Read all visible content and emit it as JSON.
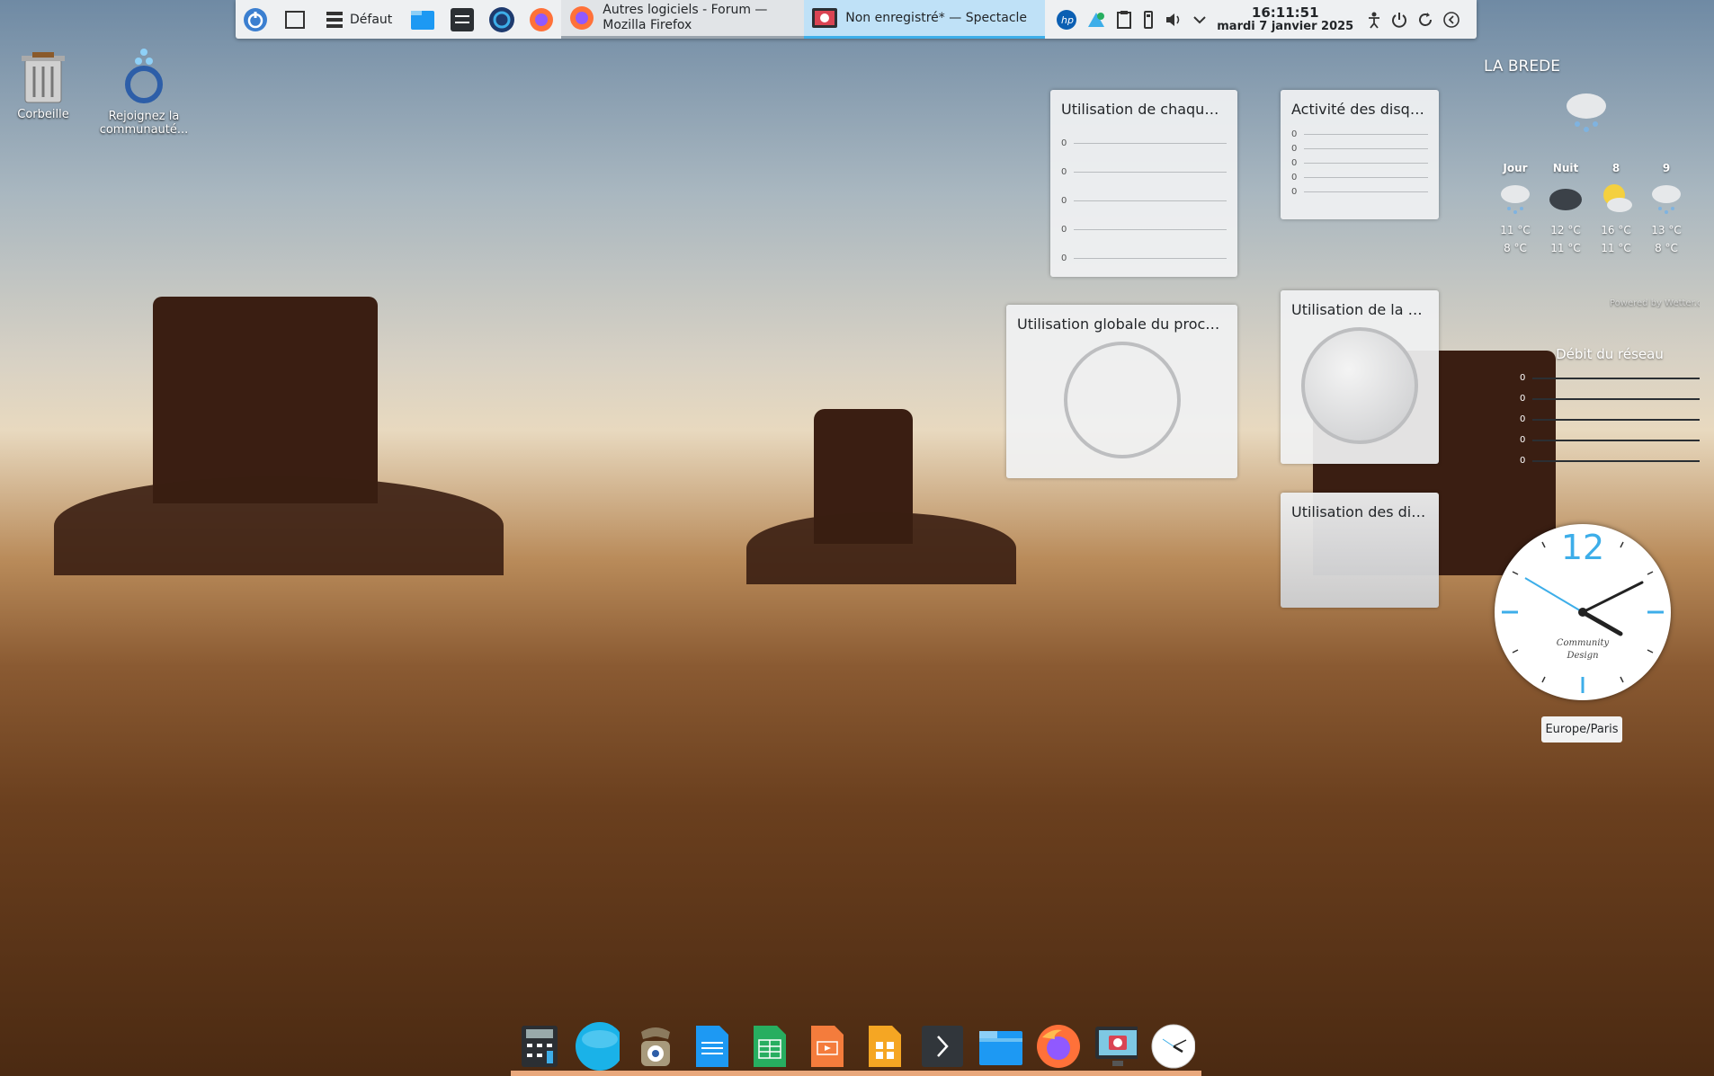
{
  "panel": {
    "launcher_icon": "kde-launcher-icon",
    "desktop_label": "Défaut",
    "tasks": [
      {
        "title": "Autres logiciels - Forum — Mozilla Firefox",
        "icon": "firefox-icon"
      },
      {
        "title": "Non enregistré* — Spectacle",
        "icon": "spectacle-icon"
      }
    ],
    "clock": {
      "time": "16:11:51",
      "date": "mardi 7 janvier 2025"
    }
  },
  "desktop_icons": [
    {
      "label": "Corbeille",
      "icon": "trash-icon"
    },
    {
      "label": "Rejoignez la communauté...",
      "icon": "community-icon"
    }
  ],
  "widgets": {
    "cpu_each": {
      "title": "Utilisation de chaque c...",
      "values": [
        "0",
        "0",
        "0",
        "0",
        "0"
      ]
    },
    "disk_activity": {
      "title": "Activité des disqu...",
      "values": [
        "0",
        "0",
        "0",
        "0",
        "0"
      ]
    },
    "cpu_global": {
      "title": "Utilisation globale du proces..."
    },
    "memory": {
      "title": "Utilisation de la m..."
    },
    "disks": {
      "title": "Utilisation des dis..."
    }
  },
  "weather": {
    "location": "LA BREDE",
    "powered_by": "Powered by Wetter.com",
    "forecast": [
      {
        "label": "Jour",
        "high": "11 °C",
        "low": "8 °C",
        "icon": "snow-rain-icon"
      },
      {
        "label": "Nuit",
        "high": "12 °C",
        "low": "11 °C",
        "icon": "dark-cloud-icon"
      },
      {
        "label": "8",
        "high": "16 °C",
        "low": "11 °C",
        "icon": "sun-cloud-icon"
      },
      {
        "label": "9",
        "high": "13 °C",
        "low": "8 °C",
        "icon": "snow-rain-icon"
      }
    ]
  },
  "network": {
    "title": "Débit du réseau",
    "values": [
      "0",
      "0",
      "0",
      "0",
      "0"
    ]
  },
  "analog_clock": {
    "twelve": "12",
    "brand_line1": "Community",
    "brand_line2": "Design",
    "timezone": "Europe/Paris"
  },
  "dock": [
    "calculator-icon",
    "browser-icon",
    "phone-icon",
    "writer-icon",
    "calc-icon",
    "impress-icon",
    "apps-icon",
    "terminal-icon",
    "folder-icon",
    "firefox-icon",
    "spectacle-icon",
    "clock-icon"
  ],
  "colors": {
    "accent": "#3daee9",
    "panel": "#eef0f2",
    "dock_base": "#e9a87c"
  }
}
